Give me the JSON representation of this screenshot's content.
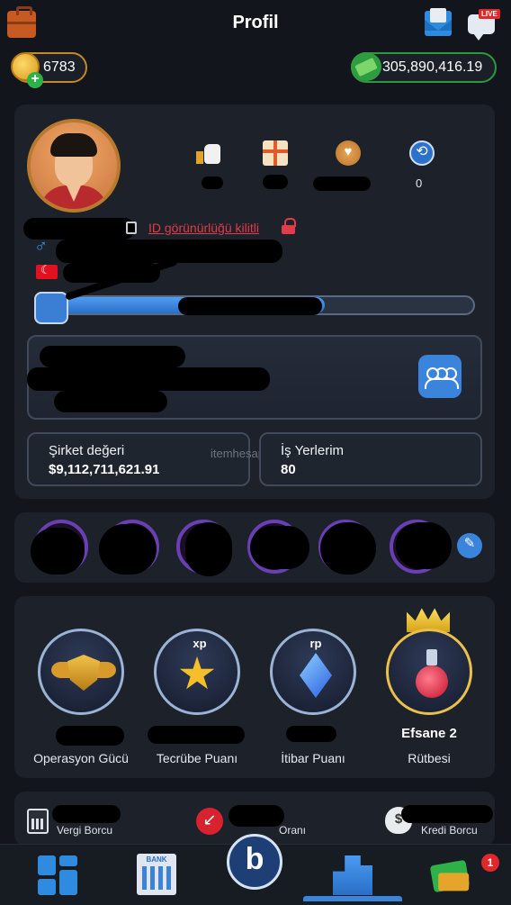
{
  "header": {
    "title": "Profil",
    "live_badge": "LIVE",
    "icons": {
      "left": "briefcase-icon",
      "mail": "mail-icon",
      "chat": "live-chat-icon"
    }
  },
  "wallet": {
    "coins": "6783",
    "cash": "305,890,416.19"
  },
  "profile": {
    "stats": {
      "history_count": "0"
    },
    "id_visibility_text": "ID görünürlüğü kilitli",
    "gender_icon": "male-icon",
    "country_flag": "turkey-flag-icon",
    "level_progress_fraction": 0.66
  },
  "company": {
    "value_label": "Şirket değeri",
    "value": "$9,112,711,621.91",
    "workplaces_label": "İş Yerlerim",
    "workplaces": "80",
    "watermark": "itemhesap"
  },
  "badges": [
    {
      "top": "",
      "label": "Operasyon Gücü",
      "icon": "operation-wings-icon"
    },
    {
      "top": "xp",
      "label": "Tecrübe Puanı",
      "icon": "star-icon"
    },
    {
      "top": "rp",
      "label": "İtibar Puanı",
      "icon": "gem-icon"
    },
    {
      "top": "",
      "label": "Rütbesi",
      "icon": "potion-icon",
      "rank": "Efsane 2"
    }
  ],
  "debts": {
    "tax_label": "Vergi Borcu",
    "rate_label": "Oranı",
    "credit_label": "Kredi Borcu"
  },
  "nav": {
    "notification_count": "1",
    "items": [
      "dashboard",
      "bank",
      "home",
      "city",
      "cards"
    ]
  },
  "colors": {
    "background": "#12151b",
    "card": "#1c212a",
    "accent": "#3b84dc",
    "danger": "#e23b4a",
    "coin_border": "#c48a2a",
    "cash_border": "#2c9a3c"
  }
}
